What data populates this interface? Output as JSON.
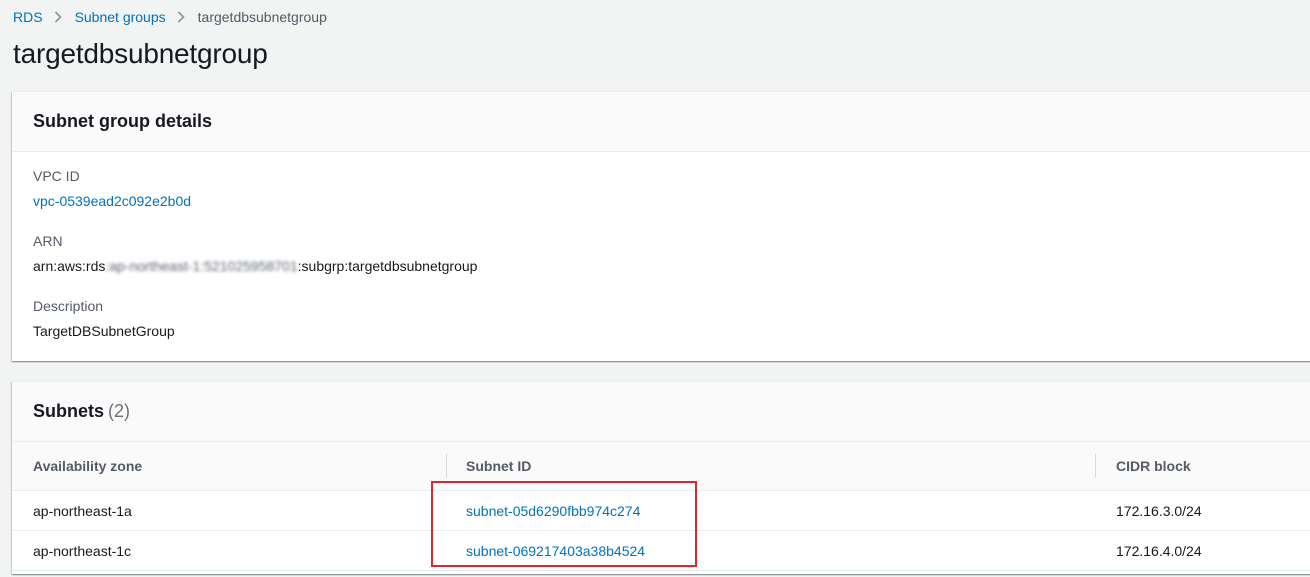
{
  "breadcrumb": [
    {
      "label": "RDS"
    },
    {
      "label": "Subnet groups"
    },
    {
      "label": "targetdbsubnetgroup"
    }
  ],
  "page_title": "targetdbsubnetgroup",
  "details": {
    "title": "Subnet group details",
    "vpc_id_label": "VPC ID",
    "vpc_id_value": "vpc-0539ead2c092e2b0d",
    "arn_label": "ARN",
    "arn_prefix": "arn:aws:rds",
    "arn_redacted": ":ap-northeast-1:521025958701",
    "arn_suffix": ":subgrp:targetdbsubnetgroup",
    "description_label": "Description",
    "description_value": "TargetDBSubnetGroup"
  },
  "subnets": {
    "title": "Subnets",
    "count": "(2)",
    "columns": [
      "Availability zone",
      "Subnet ID",
      "CIDR block"
    ],
    "rows": [
      {
        "az": "ap-northeast-1a",
        "subnet_id": "subnet-05d6290fbb974c274",
        "cidr": "172.16.3.0/24"
      },
      {
        "az": "ap-northeast-1c",
        "subnet_id": "subnet-069217403a38b4524",
        "cidr": "172.16.4.0/24"
      }
    ]
  },
  "colors": {
    "link": "#0073bb",
    "highlight": "#e0262d"
  }
}
